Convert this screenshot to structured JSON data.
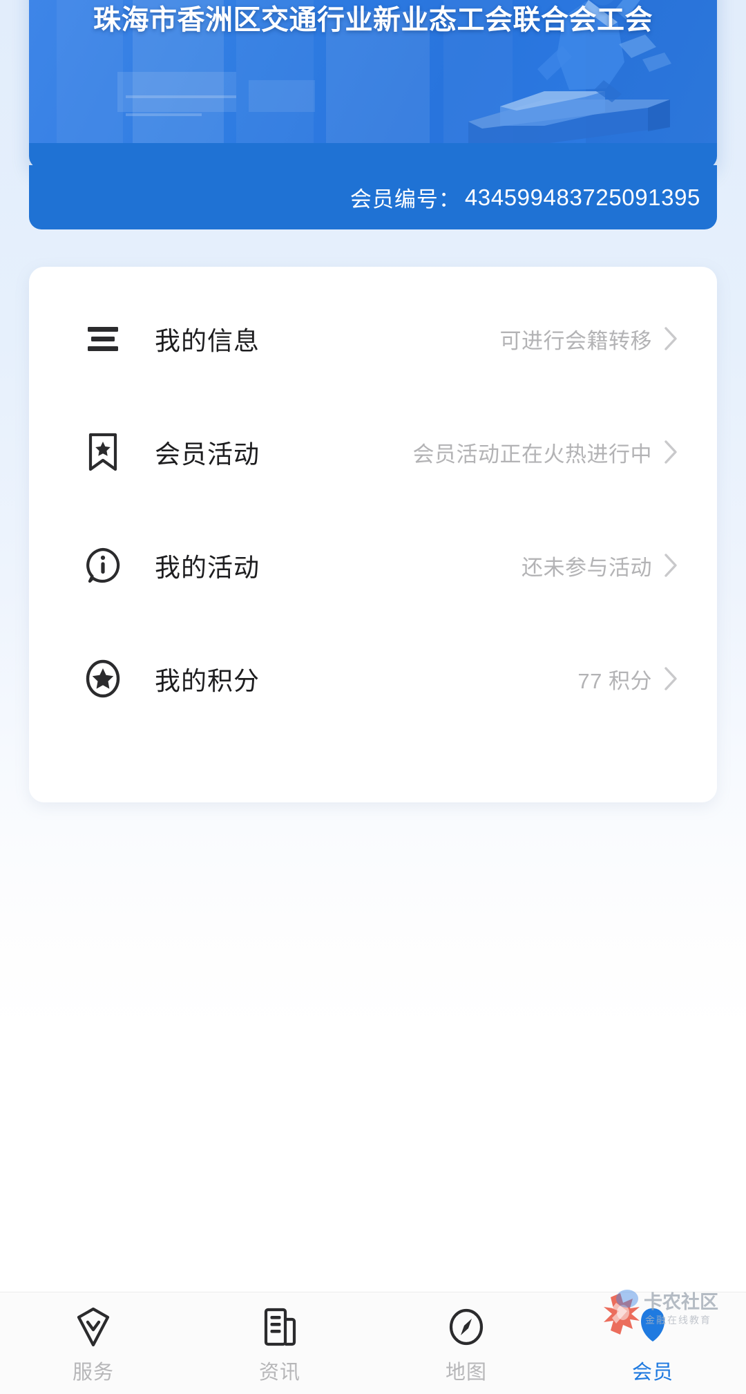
{
  "page": {
    "background_top": "#e2edfb",
    "background_bottom": "#ffffff",
    "accent_color": "#1f7ae0"
  },
  "member_card": {
    "title": "珠海市香洲区交通行业新业态工会联合会工会",
    "hero_bg": "#2f7ce2",
    "footer_bg": "#1f72d4",
    "member_no_label": "会员编号：",
    "member_no_value": "434599483725091395"
  },
  "menu": {
    "rows": [
      {
        "icon": "menu-lines-icon",
        "label": "我的信息",
        "meta": "可进行会籍转移",
        "chevron": "chevron-right-icon"
      },
      {
        "icon": "bookmark-star-icon",
        "label": "会员活动",
        "meta": "会员活动正在火热进行中",
        "chevron": "chevron-right-icon"
      },
      {
        "icon": "info-circle-icon",
        "label": "我的活动",
        "meta": "还未参与活动",
        "chevron": "chevron-right-icon"
      },
      {
        "icon": "star-circle-icon",
        "label": "我的积分",
        "meta": "77 积分",
        "chevron": "chevron-right-icon"
      }
    ]
  },
  "bottom_nav": {
    "items": [
      {
        "icon": "shield-check-icon",
        "label": "服务",
        "active": false
      },
      {
        "icon": "news-document-icon",
        "label": "资讯",
        "active": false
      },
      {
        "icon": "compass-icon",
        "label": "地图",
        "active": false
      },
      {
        "icon": "member-badge-icon",
        "label": "会员",
        "active": true
      }
    ],
    "active_color": "#1f7ae0",
    "inactive_color": "#b6b6b8"
  },
  "watermark": {
    "primary_text": "卡农社区",
    "secondary_text": "金融在线教育",
    "logo_color": "#e8432e"
  }
}
